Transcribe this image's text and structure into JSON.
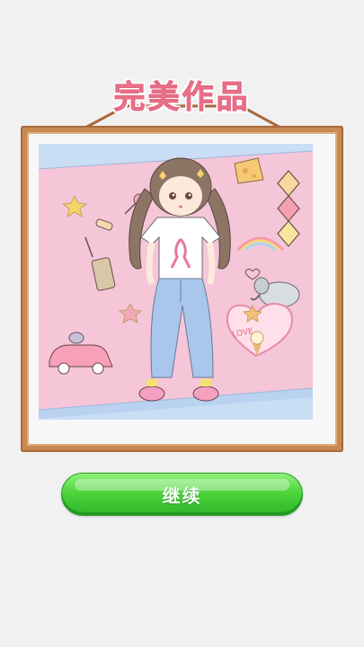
{
  "title": "完美作品",
  "continue_label": "继续",
  "artwork": {
    "shirt_graphic": "ribbon",
    "sticker_text": "LOVE",
    "items": [
      "cheese-icon",
      "diamond-tiles-icon",
      "rainbow-icon",
      "elephant-icon",
      "love-heart-icon",
      "car-icon",
      "phone-icon",
      "lollipop-icon",
      "candy-icon",
      "star-icon"
    ]
  },
  "colors": {
    "title": "#f77f96",
    "frame": "#c88a50",
    "button": "#4ed53c",
    "background_pink": "#f4c6d8",
    "background_blue": "#c9ddf5"
  }
}
